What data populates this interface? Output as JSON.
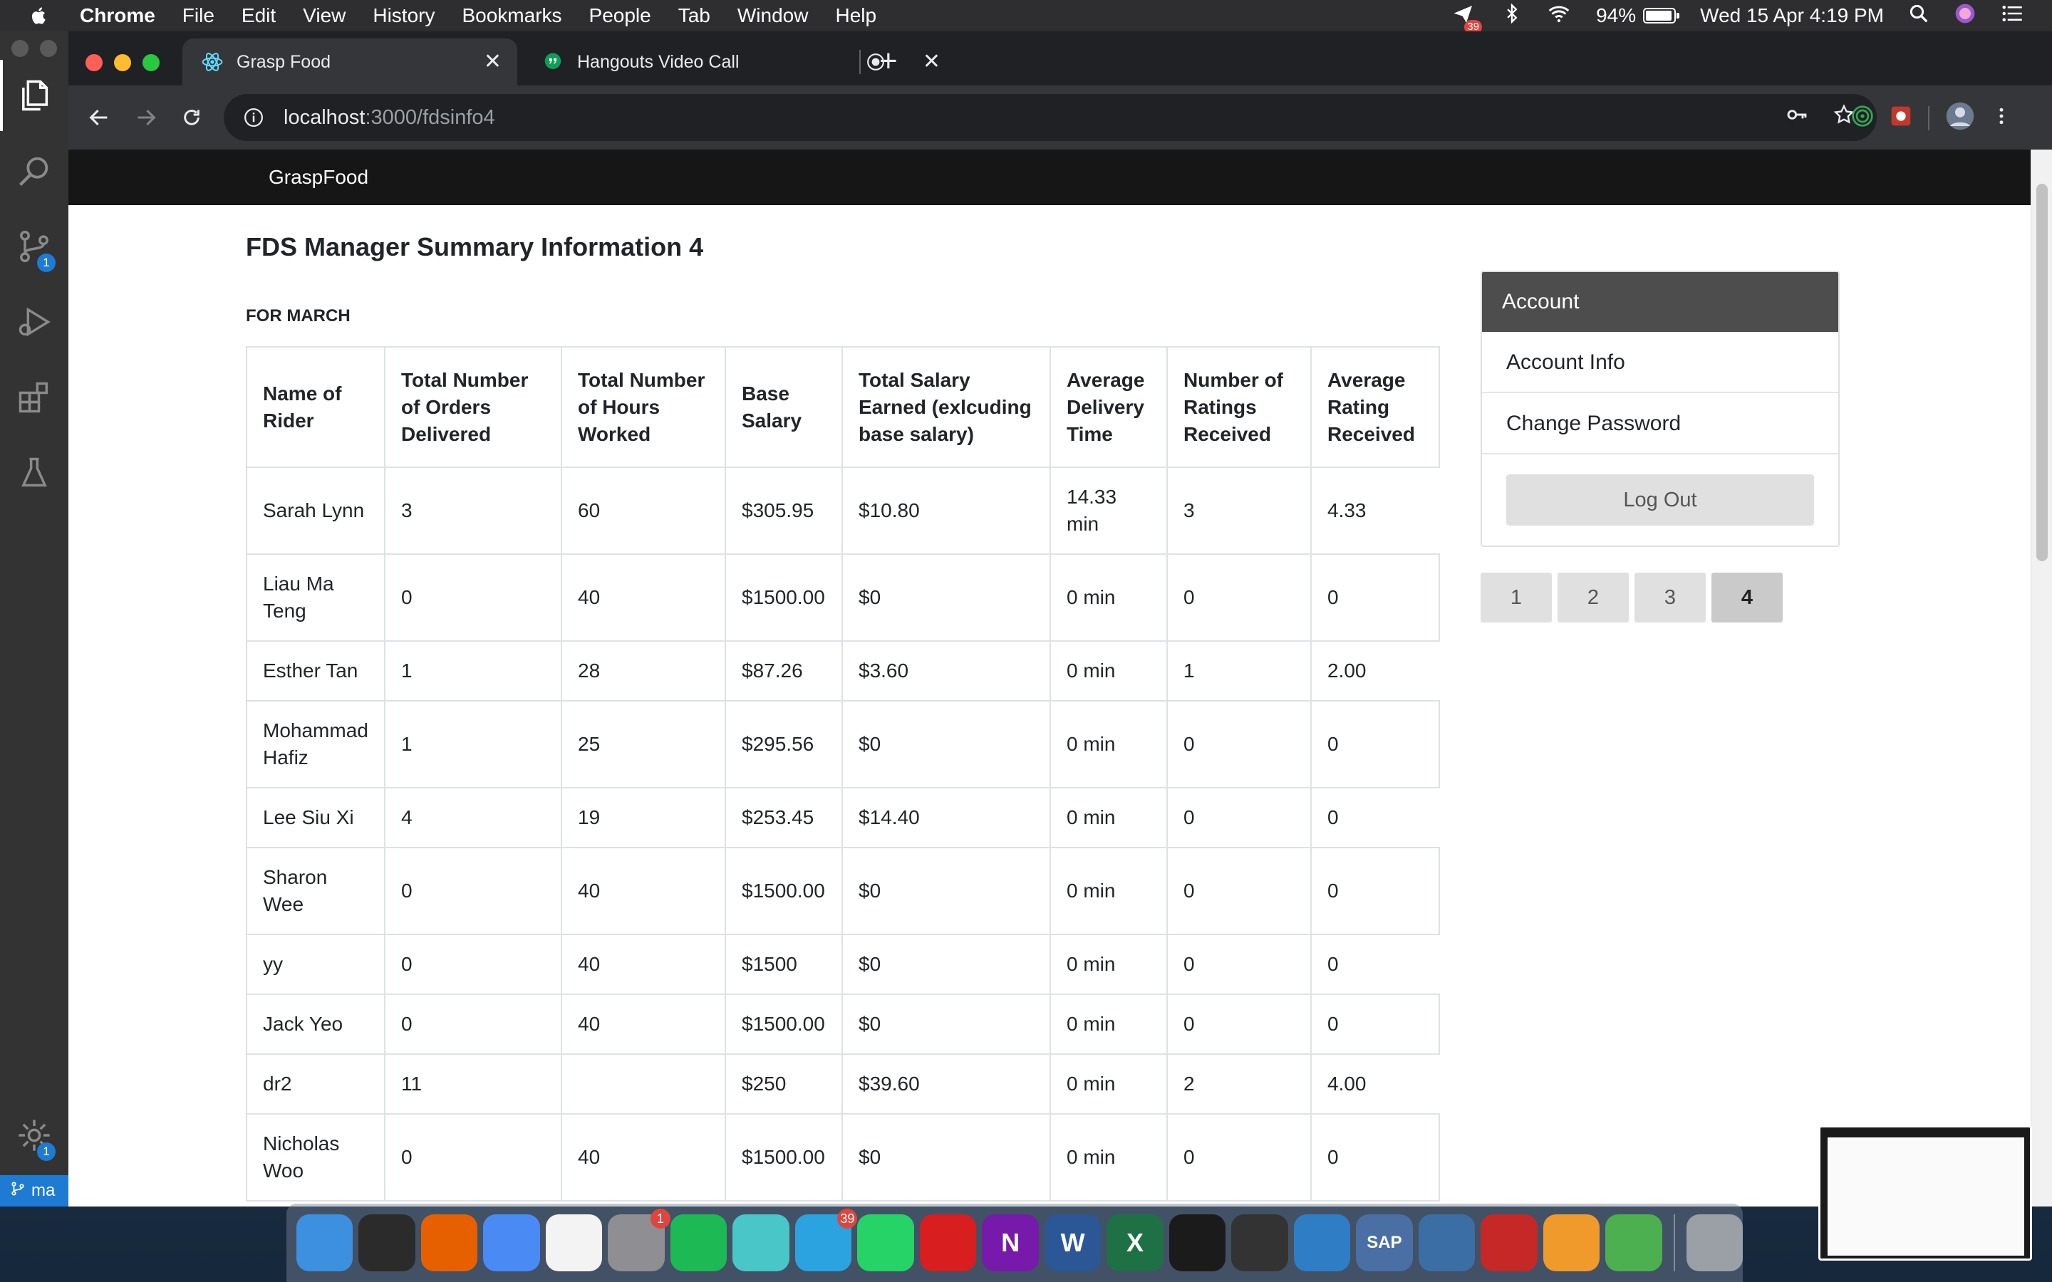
{
  "menubar": {
    "app_name": "Chrome",
    "items": [
      "File",
      "Edit",
      "View",
      "History",
      "Bookmarks",
      "People",
      "Tab",
      "Window",
      "Help"
    ],
    "notification_badge": "39",
    "battery": "94%",
    "datetime": "Wed 15 Apr  4:19 PM"
  },
  "vscode": {
    "source_control_badge": "1",
    "settings_badge": "1",
    "status_branch": "ma"
  },
  "browser": {
    "tabs": [
      {
        "title": "Grasp Food",
        "icon": "react-icon",
        "active": true
      },
      {
        "title": "Hangouts Video Call",
        "icon": "hangouts-icon",
        "active": false
      }
    ],
    "url_host": "localhost",
    "url_path": ":3000/fdsinfo4"
  },
  "site": {
    "brand": "GraspFood",
    "title": "FDS Manager Summary Information 4",
    "subtitle": "FOR MARCH",
    "table": {
      "headers": [
        "Name of Rider",
        "Total Number of Orders Delivered",
        "Total Number of Hours Worked",
        "Base Salary",
        "Total Salary Earned (exlcuding base salary)",
        "Average Delivery Time",
        "Number of Ratings Received",
        "Average Rating Received"
      ],
      "rows": [
        [
          "Sarah Lynn",
          "3",
          "60",
          "$305.95",
          "$10.80",
          "14.33 min",
          "3",
          "4.33"
        ],
        [
          "Liau Ma Teng",
          "0",
          "40",
          "$1500.00",
          "$0",
          "0 min",
          "0",
          "0"
        ],
        [
          "Esther Tan",
          "1",
          "28",
          "$87.26",
          "$3.60",
          "0 min",
          "1",
          "2.00"
        ],
        [
          "Mohammad Hafiz",
          "1",
          "25",
          "$295.56",
          "$0",
          "0 min",
          "0",
          "0"
        ],
        [
          "Lee Siu Xi",
          "4",
          "19",
          "$253.45",
          "$14.40",
          "0 min",
          "0",
          "0"
        ],
        [
          "Sharon Wee",
          "0",
          "40",
          "$1500.00",
          "$0",
          "0 min",
          "0",
          "0"
        ],
        [
          "yy",
          "0",
          "40",
          "$1500",
          "$0",
          "0 min",
          "0",
          "0"
        ],
        [
          "Jack Yeo",
          "0",
          "40",
          "$1500.00",
          "$0",
          "0 min",
          "0",
          "0"
        ],
        [
          "dr2",
          "11",
          "",
          "$250",
          "$39.60",
          "0 min",
          "2",
          "4.00"
        ],
        [
          "Nicholas Woo",
          "0",
          "40",
          "$1500.00",
          "$0",
          "0 min",
          "0",
          "0"
        ]
      ]
    },
    "account": {
      "heading": "Account",
      "items": [
        "Account Info",
        "Change Password"
      ],
      "logout": "Log Out"
    },
    "pagination": {
      "pages": [
        "1",
        "2",
        "3",
        "4"
      ],
      "current": "4"
    }
  },
  "dock": {
    "apps": [
      {
        "name": "finder-icon",
        "color": "#3d8fe0"
      },
      {
        "name": "activity-monitor-icon",
        "color": "#2b2b2b"
      },
      {
        "name": "firefox-icon",
        "color": "#e66000"
      },
      {
        "name": "chrome-icon",
        "color": "#4a8af4"
      },
      {
        "name": "textedit-icon",
        "color": "#f3f3f3"
      },
      {
        "name": "system-preferences-icon",
        "color": "#8e8e93",
        "badge": "1"
      },
      {
        "name": "spotify-icon",
        "color": "#1db954"
      },
      {
        "name": "starred-app-icon",
        "color": "#49c6c8"
      },
      {
        "name": "telegram-icon",
        "color": "#2aa3e0",
        "badge": "39"
      },
      {
        "name": "whatsapp-icon",
        "color": "#25d366"
      },
      {
        "name": "acrobat-icon",
        "color": "#d81e1e"
      },
      {
        "name": "onenote-icon",
        "color": "#7719aa",
        "letter": "N"
      },
      {
        "name": "word-icon",
        "color": "#2b5797",
        "letter": "W"
      },
      {
        "name": "excel-icon",
        "color": "#1e7145",
        "letter": "X"
      },
      {
        "name": "terminal-icon",
        "color": "#1b1b1b"
      },
      {
        "name": "terminal-2-icon",
        "color": "#333333"
      },
      {
        "name": "vscode-icon",
        "color": "#2f7dc4"
      },
      {
        "name": "sap-icon",
        "color": "#4a6fa5",
        "letter": "SAP"
      },
      {
        "name": "virtualbox-icon",
        "color": "#3a6ea5"
      },
      {
        "name": "git-app-icon",
        "color": "#c62828"
      },
      {
        "name": "sublime-icon",
        "color": "#f09a2b"
      },
      {
        "name": "checkmark-app-icon",
        "color": "#4caf50"
      },
      {
        "name": "trash-icon",
        "color": "#9aa0a6"
      }
    ]
  }
}
